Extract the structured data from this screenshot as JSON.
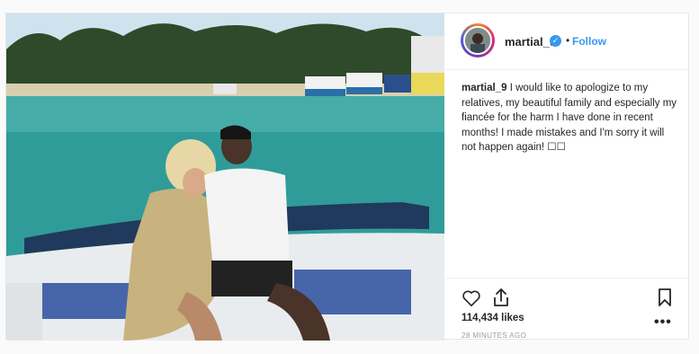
{
  "post": {
    "username": "martial_9",
    "verified_icon": "verified-badge-icon",
    "separator": "•",
    "follow_label": "Follow",
    "caption_user": "martial_9",
    "caption_text": "I would like to apologize to my relatives, my beautiful family and especially my fiancée for the harm I have done in recent months! I made mistakes and I'm sorry it will not happen again! ☐☐",
    "likes": "114,434 likes",
    "timestamp": "28 MINUTES AGO",
    "more_label": "•••"
  },
  "colors": {
    "accent": "#3897f0",
    "text": "#262626",
    "muted": "#999999"
  }
}
